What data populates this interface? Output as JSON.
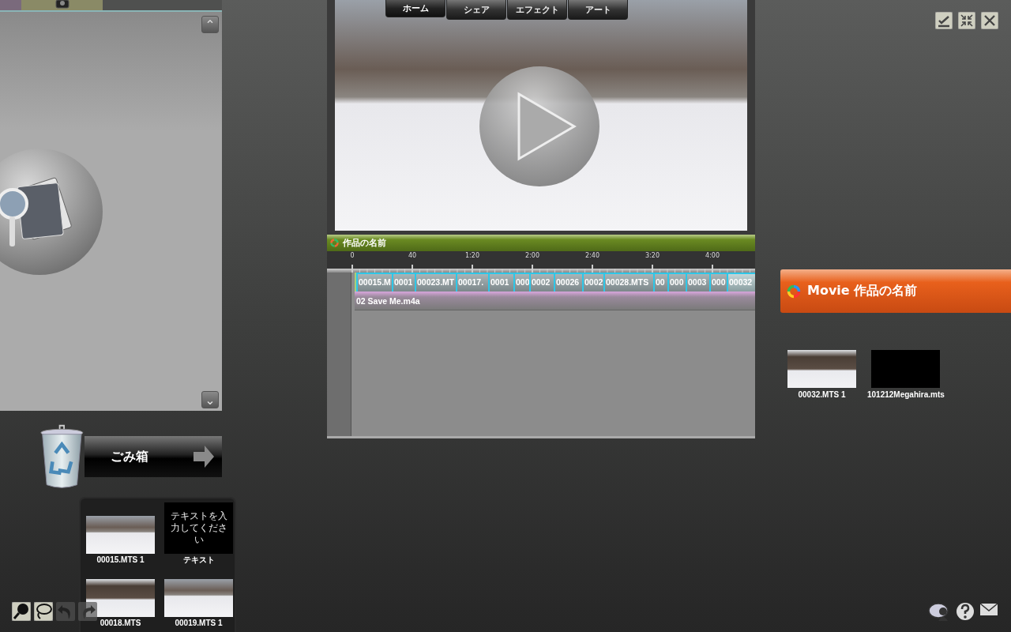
{
  "library": {
    "scroll_up": "⌃",
    "scroll_down": "⌄"
  },
  "trash": {
    "label": "ごみ箱",
    "items": [
      {
        "name": "00015.MTS 1",
        "kind": "video"
      },
      {
        "name": "00018.MTS",
        "kind": "video"
      },
      {
        "name": "テキスト",
        "kind": "text",
        "text": "テキストを入力してください"
      },
      {
        "name": "00019.MTS 1",
        "kind": "video"
      }
    ]
  },
  "preview": {
    "tabs": [
      {
        "label": "ホーム",
        "selected": true
      },
      {
        "label": "シェア",
        "selected": false
      },
      {
        "label": "エフェクト",
        "selected": false
      },
      {
        "label": "アート",
        "selected": false
      }
    ]
  },
  "timeline": {
    "title": "作品の名前",
    "ruler": [
      "0",
      "40",
      "1:20",
      "2:00",
      "2:40",
      "3:20",
      "4:00"
    ],
    "clips": [
      {
        "label": "00015.M",
        "selected": false
      },
      {
        "label": "0001",
        "selected": false
      },
      {
        "label": "00023.MT",
        "selected": false
      },
      {
        "label": "00017.",
        "selected": false
      },
      {
        "label": "0001",
        "selected": false
      },
      {
        "label": "000",
        "selected": false
      },
      {
        "label": "0002",
        "selected": false
      },
      {
        "label": "00026",
        "selected": false
      },
      {
        "label": "0002",
        "selected": false
      },
      {
        "label": "00028.MTS",
        "selected": false
      },
      {
        "label": "00",
        "selected": false
      },
      {
        "label": "000",
        "selected": false
      },
      {
        "label": "0003",
        "selected": false
      },
      {
        "label": "000",
        "selected": false
      },
      {
        "label": "00032",
        "selected": true
      }
    ],
    "audio": "02 Save Me.m4a"
  },
  "project": {
    "title": "Movie 作品の名前",
    "items": [
      {
        "name": "00032.MTS 1",
        "kind": "video"
      },
      {
        "name": "101212Megahira.mts",
        "kind": "blank"
      }
    ]
  }
}
